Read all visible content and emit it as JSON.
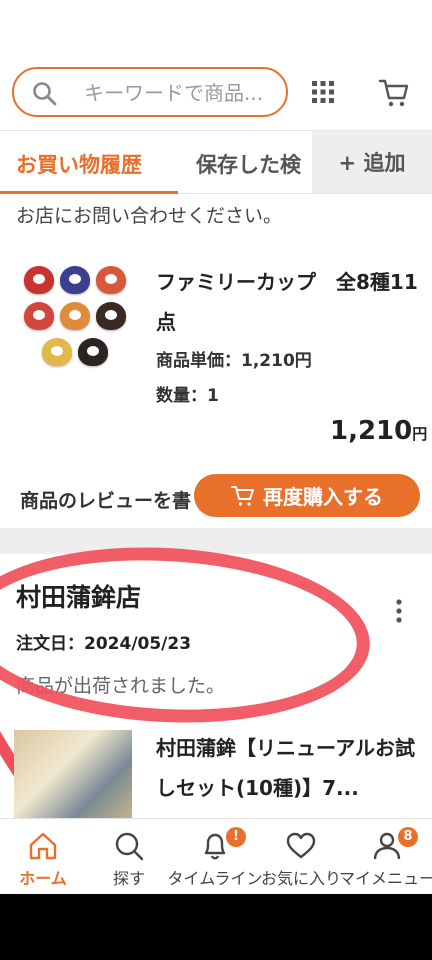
{
  "search": {
    "placeholder": "キーワードで商品..."
  },
  "tabs": [
    {
      "label": "お買い物履歴"
    },
    {
      "label": "保存した検"
    }
  ],
  "add_tab_label": "+ 追加",
  "order1": {
    "notice": "お店にお問い合わせください。",
    "product_name": "ファミリーカップ　全8種11点",
    "unit_price": "商品単価：1,210円",
    "quantity": "数量：1",
    "total_value": "1,210",
    "total_unit": "円",
    "review_text": "商品のレビューを書く",
    "rebuy_label": "再度購入する"
  },
  "order2": {
    "shop_name": "村田蒲鉾店",
    "order_date": "注文日：2024/05/23",
    "status": "商品が出荷されました。",
    "product_name": "村田蒲鉾【リニューアルお試しセット(10種)】7..."
  },
  "bottom_nav": [
    {
      "label": "ホーム",
      "icon": "home-icon"
    },
    {
      "label": "探す",
      "icon": "search-icon"
    },
    {
      "label": "タイムライン",
      "icon": "bell-icon",
      "badge": "!"
    },
    {
      "label": "お気に入り",
      "icon": "heart-icon"
    },
    {
      "label": "マイメニュー",
      "icon": "person-icon",
      "badge": "8"
    }
  ],
  "colors": {
    "accent": "#e8702a",
    "annotation": "#f0505a"
  }
}
